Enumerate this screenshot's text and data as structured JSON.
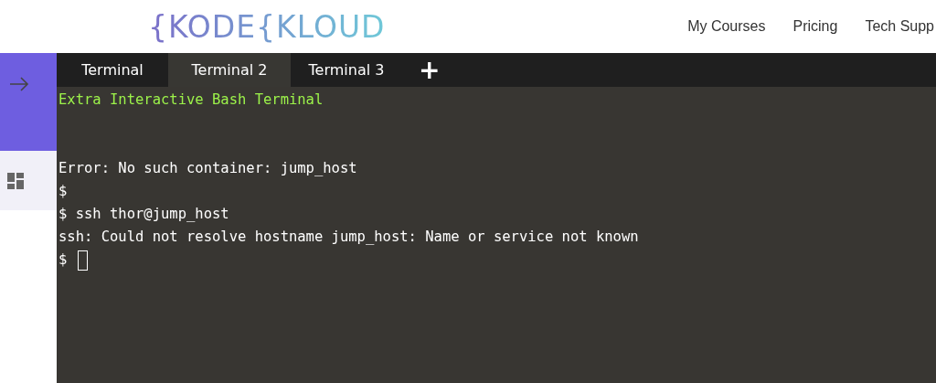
{
  "header": {
    "logo": "{KODE{KLOUD",
    "nav": [
      "My Courses",
      "Pricing",
      "Tech Supp"
    ]
  },
  "tabs": [
    {
      "label": "Terminal",
      "selected": false
    },
    {
      "label": "Terminal 2",
      "selected": true
    },
    {
      "label": "Terminal 3",
      "selected": false
    }
  ],
  "add_tab": "+",
  "terminal": {
    "lines": [
      {
        "kind": "banner",
        "text": "Extra Interactive Bash Terminal"
      },
      {
        "kind": "blank"
      },
      {
        "kind": "blank"
      },
      {
        "kind": "output",
        "text": "Error: No such container: jump_host"
      },
      {
        "kind": "output",
        "text": "$"
      },
      {
        "kind": "output",
        "text": "$ ssh thor@jump_host"
      },
      {
        "kind": "output",
        "text": "ssh: Could not resolve hostname jump_host: Name or service not known"
      },
      {
        "kind": "prompt",
        "text": "$",
        "cursor": true
      }
    ]
  }
}
